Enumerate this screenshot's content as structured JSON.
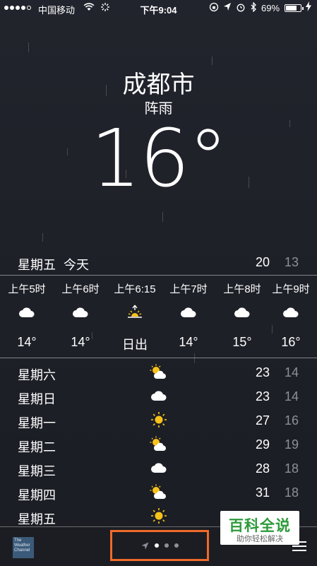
{
  "status_bar": {
    "carrier": "中国移动",
    "time": "下午9:04",
    "battery_percent": "69%",
    "battery_level": 0.69
  },
  "header": {
    "city": "成都市",
    "condition": "阵雨",
    "temperature": "16°"
  },
  "today": {
    "day": "星期五",
    "label": "今天",
    "high": "20",
    "low": "13"
  },
  "hourly": [
    {
      "time": "上午5时",
      "icon": "cloud-icon",
      "value": "14°"
    },
    {
      "time": "上午6时",
      "icon": "cloud-icon",
      "value": "14°"
    },
    {
      "time": "上午6:15",
      "icon": "sunrise-icon",
      "value": "日出"
    },
    {
      "time": "上午7时",
      "icon": "cloud-icon",
      "value": "14°"
    },
    {
      "time": "上午8时",
      "icon": "cloud-icon",
      "value": "15°"
    },
    {
      "time": "上午9时",
      "icon": "cloud-icon",
      "value": "16°"
    }
  ],
  "daily": [
    {
      "day": "星期六",
      "icon": "partly-cloudy-icon",
      "high": "23",
      "low": "14"
    },
    {
      "day": "星期日",
      "icon": "cloud-icon",
      "high": "23",
      "low": "14"
    },
    {
      "day": "星期一",
      "icon": "sun-icon",
      "high": "27",
      "low": "16"
    },
    {
      "day": "星期二",
      "icon": "partly-cloudy-icon",
      "high": "29",
      "low": "19"
    },
    {
      "day": "星期三",
      "icon": "cloud-icon",
      "high": "28",
      "low": "18"
    },
    {
      "day": "星期四",
      "icon": "partly-cloudy-icon",
      "high": "31",
      "low": "18"
    },
    {
      "day": "星期五",
      "icon": "sun-icon",
      "high": "",
      "low": ""
    }
  ],
  "bottom_bar": {
    "logo_text": "The Weather Channel",
    "page_count": 3,
    "current_page": 1
  },
  "watermark": {
    "title": "百科全说",
    "subtitle": "助你轻松解决"
  },
  "colors": {
    "background": "#1f2129",
    "sun": "#f7c21a",
    "low_temp": "#8e9099",
    "highlight": "#f06a2a",
    "watermark_green": "#2d9a3a"
  }
}
